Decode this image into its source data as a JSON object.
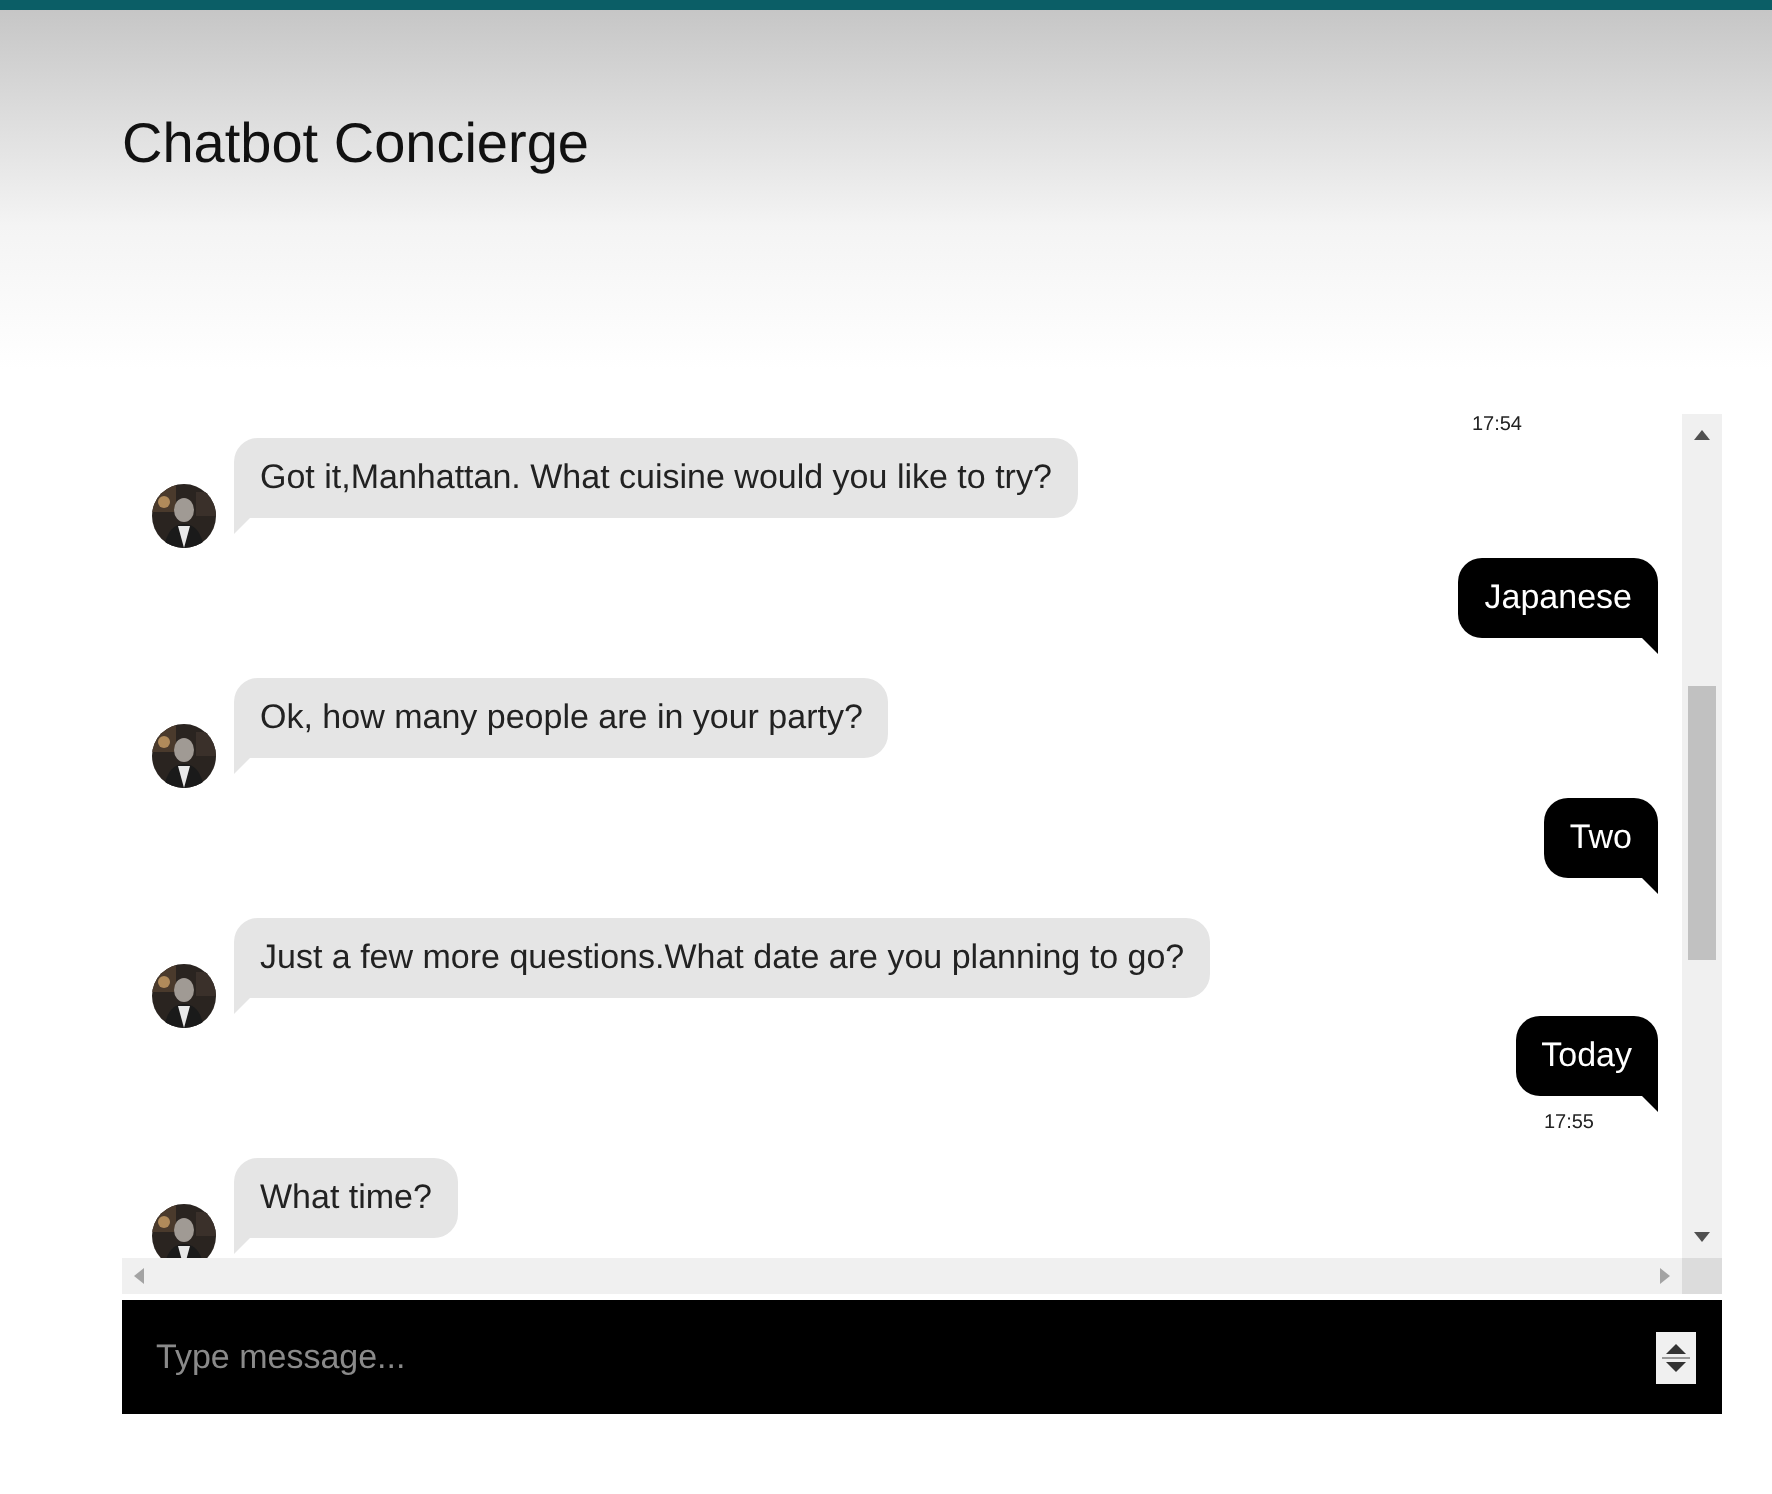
{
  "header": {
    "title": "Chatbot Concierge"
  },
  "messages": [
    {
      "kind": "timestamp",
      "text": "17:54"
    },
    {
      "kind": "bot",
      "text": "Got it,Manhattan. What cuisine would you like to try?"
    },
    {
      "kind": "user",
      "text": "Japanese"
    },
    {
      "kind": "bot",
      "text": "Ok, how many people are in your party?"
    },
    {
      "kind": "user",
      "text": "Two"
    },
    {
      "kind": "bot",
      "text": "Just a few more questions.What date are you planning to go?"
    },
    {
      "kind": "user",
      "text": "Today",
      "time": "17:55"
    },
    {
      "kind": "bot",
      "text": "What time?"
    }
  ],
  "composer": {
    "placeholder": "Type message..."
  }
}
